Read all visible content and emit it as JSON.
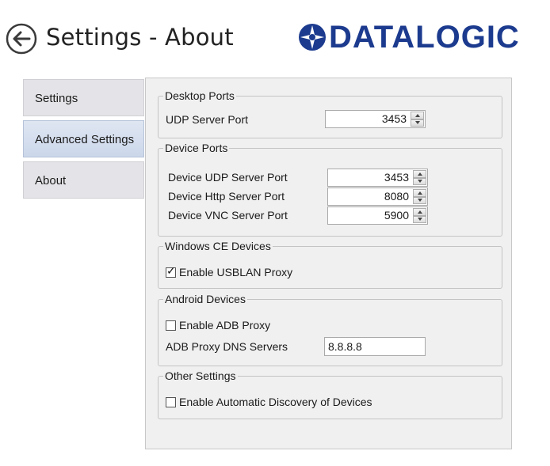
{
  "header": {
    "title": "Settings - About",
    "logo_text": "DATALOGIC",
    "brand_color": "#1c3b8f",
    "back_icon": "back-arrow-icon"
  },
  "tabs": [
    {
      "label": "Settings",
      "active": false
    },
    {
      "label": "Advanced Settings",
      "active": true
    },
    {
      "label": "About",
      "active": false
    }
  ],
  "desktop_ports": {
    "title": "Desktop Ports",
    "udp_label": "UDP Server Port",
    "udp_value": "3453"
  },
  "device_ports": {
    "title": "Device Ports",
    "udp_label": "Device UDP Server Port",
    "udp_value": "3453",
    "http_label": "Device Http Server Port",
    "http_value": "8080",
    "vnc_label": "Device VNC Server Port",
    "vnc_value": "5900"
  },
  "windows_ce": {
    "title": "Windows CE Devices",
    "usblan_label": "Enable USBLAN Proxy",
    "usblan_checked": true
  },
  "android": {
    "title": "Android Devices",
    "adb_label": "Enable ADB Proxy",
    "adb_checked": false,
    "dns_label": "ADB Proxy DNS Servers",
    "dns_value": "8.8.8.8"
  },
  "other": {
    "title": "Other Settings",
    "discovery_label": "Enable Automatic Discovery of Devices",
    "discovery_checked": false
  }
}
